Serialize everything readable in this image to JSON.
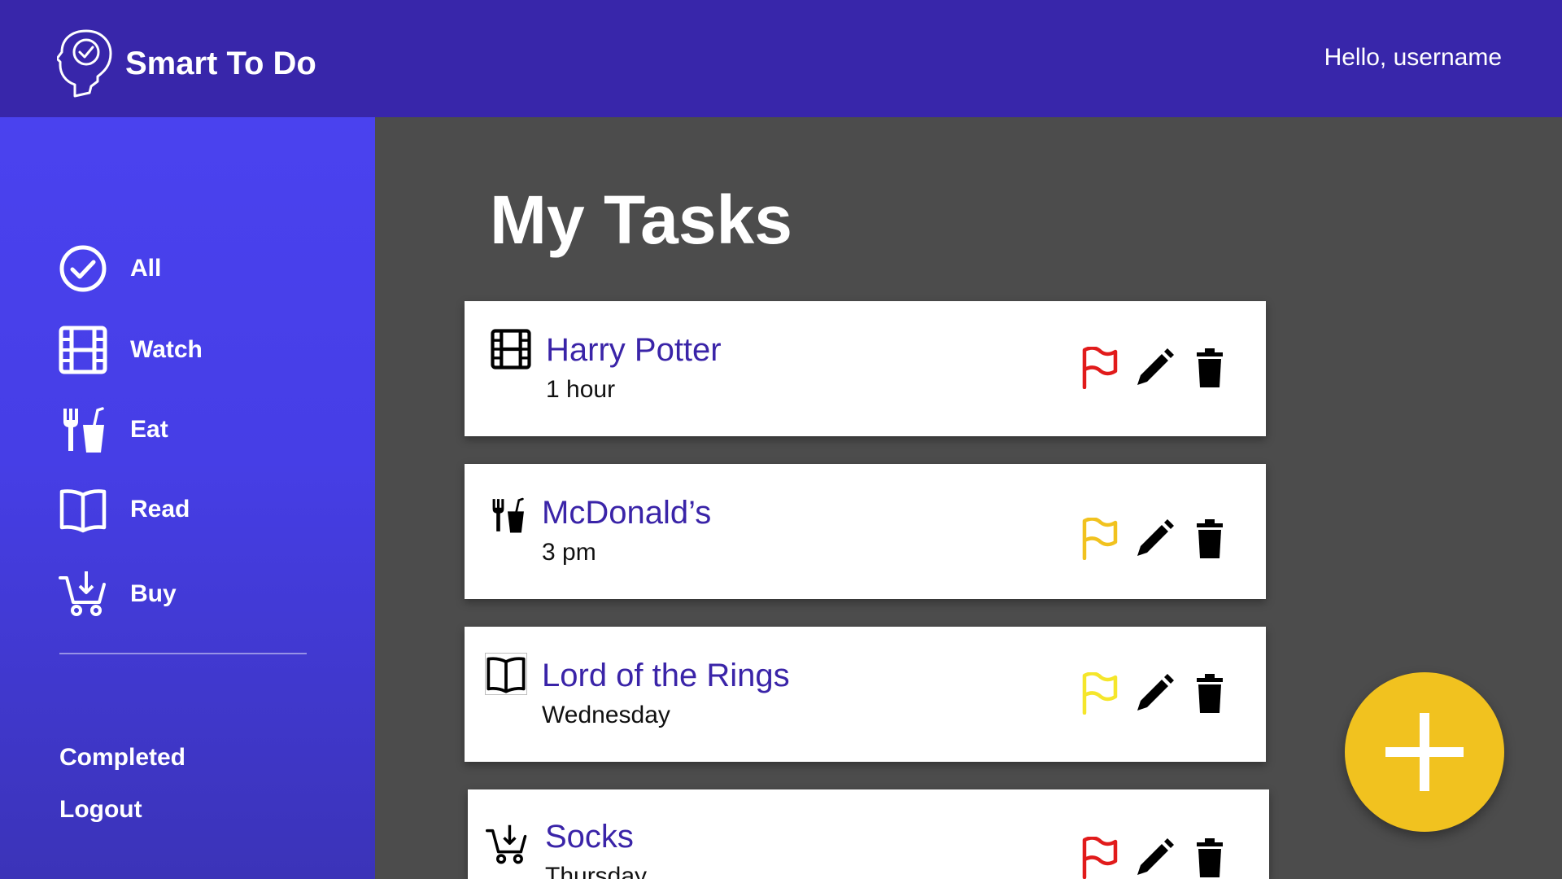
{
  "header": {
    "app_name": "Smart To Do",
    "greeting": "Hello, username",
    "logo_icon": "head-check-icon"
  },
  "sidebar": {
    "categories": [
      {
        "label": "All",
        "icon": "check-circle-icon"
      },
      {
        "label": "Watch",
        "icon": "film-icon"
      },
      {
        "label": "Eat",
        "icon": "utensils-drink-icon"
      },
      {
        "label": "Read",
        "icon": "open-book-icon"
      },
      {
        "label": "Buy",
        "icon": "cart-icon"
      }
    ],
    "completed_label": "Completed",
    "logout_label": "Logout"
  },
  "main": {
    "title": "My Tasks",
    "tasks": [
      {
        "title": "Harry Potter",
        "subtitle": "1 hour",
        "category_icon": "film-icon",
        "flag_color": "#e11b1b"
      },
      {
        "title": "McDonald’s",
        "subtitle": "3 pm",
        "category_icon": "utensils-drink-icon",
        "flag_color": "#f1c21f"
      },
      {
        "title": "Lord of the Rings",
        "subtitle": "Wednesday",
        "category_icon": "open-book-icon",
        "flag_color": "#f5e62b"
      },
      {
        "title": "Socks",
        "subtitle": "Thursday",
        "category_icon": "cart-icon",
        "flag_color": "#e11b1b"
      }
    ]
  },
  "colors": {
    "header_bg": "#3826aa",
    "sidebar_bg": "#4a42ef",
    "main_bg": "#4c4c4c",
    "task_title": "#3a24a8",
    "fab": "#f1c21f"
  },
  "fab_icon": "plus-icon"
}
